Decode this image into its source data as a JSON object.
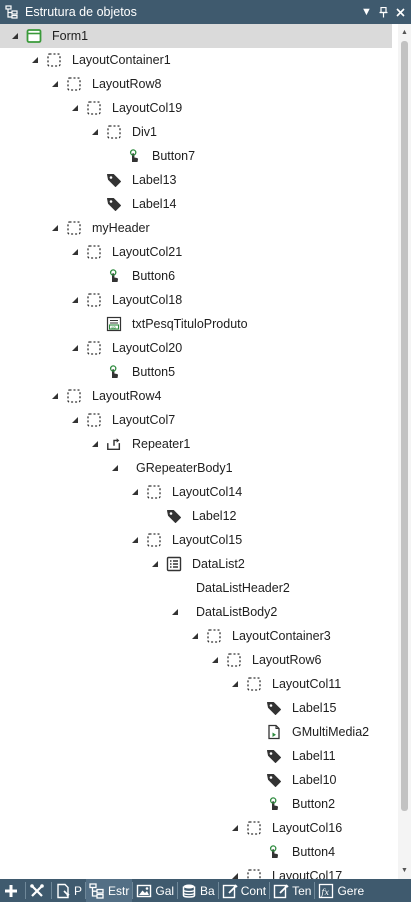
{
  "window": {
    "title": "Estrutura de objetos"
  },
  "tree": [
    {
      "label": "Form1",
      "level": 0,
      "icon": "form-icon",
      "expander": "expanded",
      "selected": true
    },
    {
      "label": "LayoutContainer1",
      "level": 1,
      "icon": "layout-icon",
      "expander": "expanded"
    },
    {
      "label": "LayoutRow8",
      "level": 2,
      "icon": "layout-icon",
      "expander": "expanded"
    },
    {
      "label": "LayoutCol19",
      "level": 3,
      "icon": "layout-icon",
      "expander": "expanded"
    },
    {
      "label": "Div1",
      "level": 4,
      "icon": "layout-icon",
      "expander": "expanded"
    },
    {
      "label": "Button7",
      "level": 5,
      "icon": "button-icon",
      "expander": "none"
    },
    {
      "label": "Label13",
      "level": 4,
      "icon": "label-icon",
      "expander": "none"
    },
    {
      "label": "Label14",
      "level": 4,
      "icon": "label-icon",
      "expander": "none"
    },
    {
      "label": "myHeader",
      "level": 2,
      "icon": "layout-icon",
      "expander": "expanded"
    },
    {
      "label": "LayoutCol21",
      "level": 3,
      "icon": "layout-icon",
      "expander": "expanded"
    },
    {
      "label": "Button6",
      "level": 4,
      "icon": "button-icon",
      "expander": "none"
    },
    {
      "label": "LayoutCol18",
      "level": 3,
      "icon": "layout-icon",
      "expander": "expanded"
    },
    {
      "label": "txtPesqTituloProduto",
      "level": 4,
      "icon": "textbox-icon",
      "expander": "none"
    },
    {
      "label": "LayoutCol20",
      "level": 3,
      "icon": "layout-icon",
      "expander": "expanded"
    },
    {
      "label": "Button5",
      "level": 4,
      "icon": "button-icon",
      "expander": "none"
    },
    {
      "label": "LayoutRow4",
      "level": 2,
      "icon": "layout-icon",
      "expander": "expanded"
    },
    {
      "label": "LayoutCol7",
      "level": 3,
      "icon": "layout-icon",
      "expander": "expanded"
    },
    {
      "label": "Repeater1",
      "level": 4,
      "icon": "repeater-icon",
      "expander": "expanded"
    },
    {
      "label": "GRepeaterBody1",
      "level": 5,
      "icon": "none",
      "expander": "expanded"
    },
    {
      "label": "LayoutCol14",
      "level": 6,
      "icon": "layout-icon",
      "expander": "expanded"
    },
    {
      "label": "Label12",
      "level": 7,
      "icon": "label-icon",
      "expander": "none"
    },
    {
      "label": "LayoutCol15",
      "level": 6,
      "icon": "layout-icon",
      "expander": "expanded"
    },
    {
      "label": "DataList2",
      "level": 7,
      "icon": "datalist-icon",
      "expander": "expanded"
    },
    {
      "label": "DataListHeader2",
      "level": 8,
      "icon": "none",
      "expander": "none"
    },
    {
      "label": "DataListBody2",
      "level": 8,
      "icon": "none",
      "expander": "expanded"
    },
    {
      "label": "LayoutContainer3",
      "level": 9,
      "icon": "layout-icon",
      "expander": "expanded"
    },
    {
      "label": "LayoutRow6",
      "level": 10,
      "icon": "layout-icon",
      "expander": "expanded"
    },
    {
      "label": "LayoutCol11",
      "level": 11,
      "icon": "layout-icon",
      "expander": "expanded"
    },
    {
      "label": "Label15",
      "level": 12,
      "icon": "label-icon",
      "expander": "none"
    },
    {
      "label": "GMultiMedia2",
      "level": 12,
      "icon": "multimedia-icon",
      "expander": "none"
    },
    {
      "label": "Label11",
      "level": 12,
      "icon": "label-icon",
      "expander": "none"
    },
    {
      "label": "Label10",
      "level": 12,
      "icon": "label-icon",
      "expander": "none"
    },
    {
      "label": "Button2",
      "level": 12,
      "icon": "button-icon",
      "expander": "none"
    },
    {
      "label": "LayoutCol16",
      "level": 11,
      "icon": "layout-icon",
      "expander": "expanded"
    },
    {
      "label": "Button4",
      "level": 12,
      "icon": "button-icon",
      "expander": "none"
    },
    {
      "label": "LayoutCol17",
      "level": 11,
      "icon": "layout-icon",
      "expander": "expanded"
    }
  ],
  "toolbar": [
    {
      "label": "",
      "icon": "add-icon"
    },
    {
      "label": "",
      "icon": "tools-icon"
    },
    {
      "label": "P",
      "icon": "properties-icon"
    },
    {
      "label": "Estr",
      "icon": "structure-icon",
      "active": true
    },
    {
      "label": "Gal",
      "icon": "gallery-icon"
    },
    {
      "label": "Ba",
      "icon": "database-icon"
    },
    {
      "label": "Cont",
      "icon": "controls-icon"
    },
    {
      "label": "Ten",
      "icon": "templates-icon"
    },
    {
      "label": "Gere",
      "icon": "functions-icon"
    }
  ],
  "colors": {
    "titlebar": "#3f5a6e",
    "selection": "#dadada",
    "button_accent": "#2e8b3e",
    "form_accent": "#3a9a3a"
  }
}
